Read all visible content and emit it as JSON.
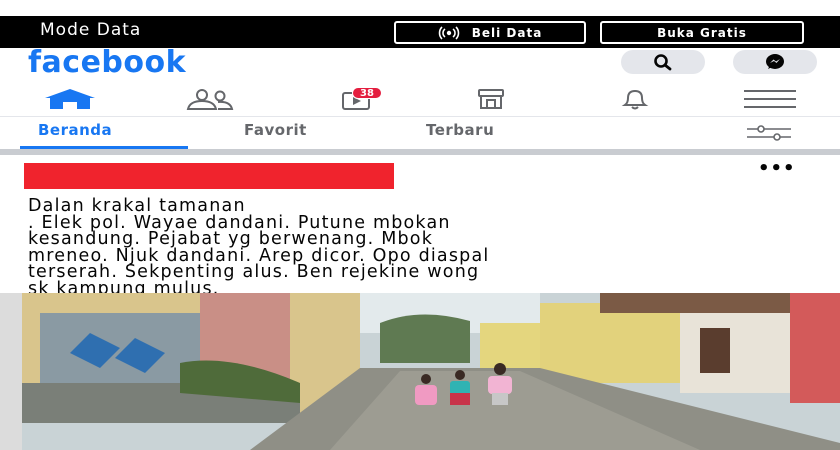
{
  "databar": {
    "mode_label": "Mode Data",
    "beli_label": "Beli Data",
    "gratis_label": "Buka Gratis"
  },
  "header": {
    "logo": "facebook"
  },
  "nav": {
    "video_badge": "38"
  },
  "tabs": [
    {
      "label": "Beranda",
      "active": true
    },
    {
      "label": "Favorit",
      "active": false
    },
    {
      "label": "Terbaru",
      "active": false
    }
  ],
  "post": {
    "more_label": "•••",
    "text_lines": [
      "Dalan krakal tamanan",
      ". Elek pol. Wayae dandani. Putune mbokan",
      "kesandung. Pejabat yg berwenang. Mbok",
      "mreneo. Njuk dandani. Arep dicor. Opo diaspal",
      "terserah. Sekpenting alus. Ben rejekine wong",
      "sk kampung mulus."
    ]
  },
  "colors": {
    "brand": "#1877f2",
    "badge": "#e41e3f",
    "name_redaction": "#f0232d"
  }
}
